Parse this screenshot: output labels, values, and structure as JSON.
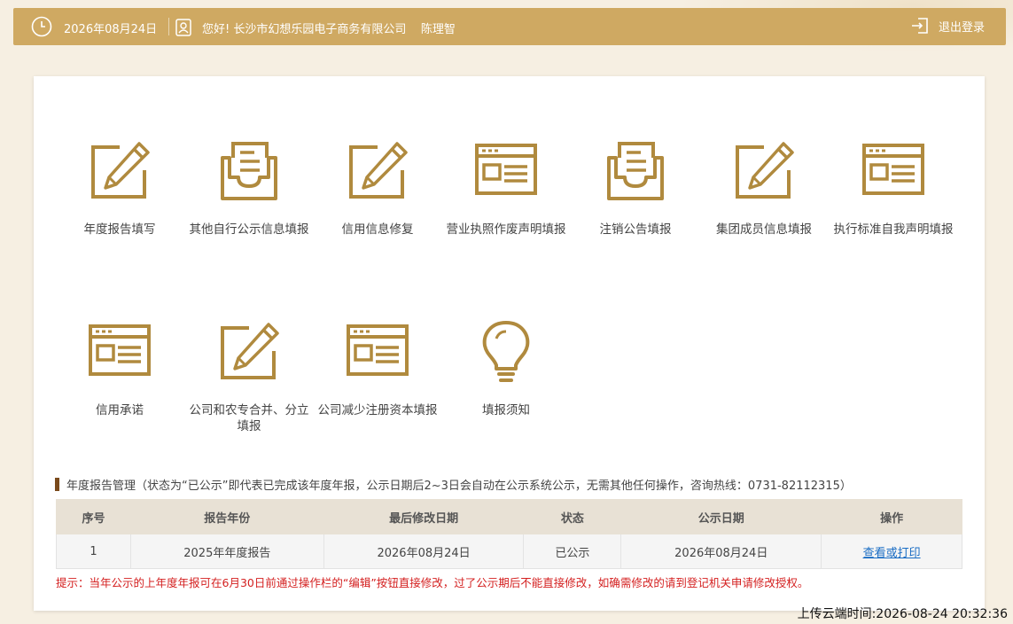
{
  "header": {
    "date": "2026年08月24日",
    "greeting": "您好! 长沙市幻想乐园电子商务有限公司    陈理智",
    "logout_label": "退出登录"
  },
  "tiles": [
    {
      "label": "年度报告填写",
      "icon": "edit-pencil-icon"
    },
    {
      "label": "其他自行公示信息填报",
      "icon": "inbox-tray-icon"
    },
    {
      "label": "信用信息修复",
      "icon": "edit-pencil-icon"
    },
    {
      "label": "营业执照作废声明填报",
      "icon": "form-window-icon"
    },
    {
      "label": "注销公告填报",
      "icon": "inbox-tray-icon"
    },
    {
      "label": "集团成员信息填报",
      "icon": "edit-pencil-icon"
    },
    {
      "label": "执行标准自我声明填报",
      "icon": "form-window-icon"
    },
    {
      "label": "信用承诺",
      "icon": "form-window-icon"
    },
    {
      "label": "公司和农专合并、分立填报",
      "icon": "edit-pencil-icon"
    },
    {
      "label": "公司减少注册资本填报",
      "icon": "form-window-icon"
    },
    {
      "label": "填报须知",
      "icon": "lightbulb-icon"
    }
  ],
  "report_section": {
    "title": "年度报告管理（状态为“已公示”即代表已完成该年度年报，公示日期后2~3日会自动在公示系统公示，无需其他任何操作，咨询热线：0731-82112315）",
    "columns": [
      "序号",
      "报告年份",
      "最后修改日期",
      "状态",
      "公示日期",
      "操作"
    ],
    "rows": [
      {
        "no": "1",
        "year": "2025年年度报告",
        "modified": "2026年08月24日",
        "status": "已公示",
        "published": "2026年08月24日",
        "action": "查看或打印"
      }
    ],
    "hint": "提示：当年公示的上年度年报可在6月30日前通过操作栏的“编辑”按钮直接修改，过了公示期后不能直接修改，如确需修改的请到登记机关申请修改授权。"
  },
  "footer": {
    "upload_time": "上传云端时间:2026-08-24 20:32:36"
  },
  "colors": {
    "gold": "#b08a3e",
    "topbar": "#cfa962",
    "hint_red": "#d42020",
    "link_blue": "#1a6dc4"
  }
}
